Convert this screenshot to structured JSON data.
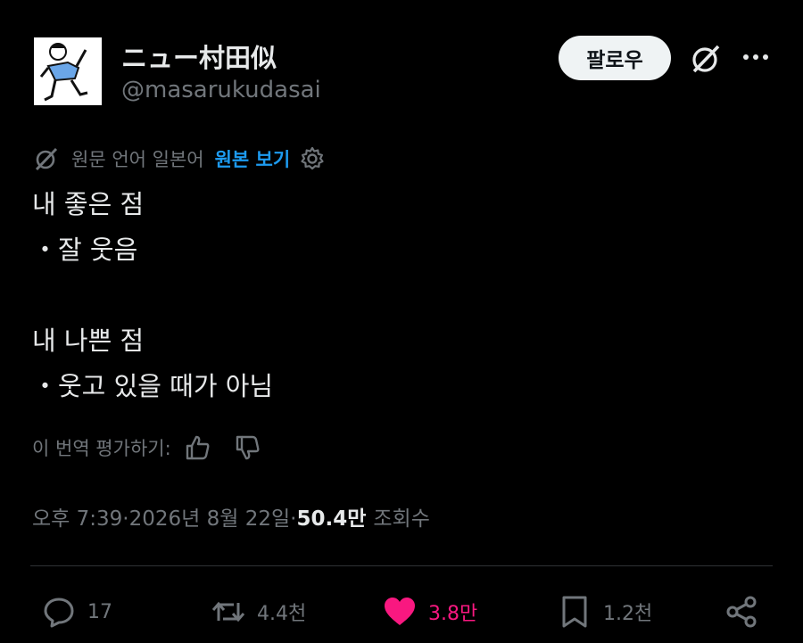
{
  "author": {
    "display_name": "ニュー村田似",
    "handle": "@masarukudasai"
  },
  "header": {
    "follow_label": "팔로우"
  },
  "translation": {
    "source_label": "원문 언어 일본어",
    "show_original_label": "원본 보기"
  },
  "tweet": {
    "lines": [
      "내 좋은 점",
      "・잘 웃음",
      "",
      "내 나쁜 점",
      "・웃고 있을 때가 아님"
    ]
  },
  "rating": {
    "label": "이 번역 평가하기:"
  },
  "meta": {
    "time": "오후 7:39",
    "separator": " · ",
    "date": "2026년 8월 22일",
    "views_count": "50.4만",
    "views_label": "조회수"
  },
  "actions": {
    "replies": "17",
    "reposts": "4.4천",
    "likes": "3.8만",
    "bookmarks": "1.2천"
  },
  "colors": {
    "background": "#000000",
    "text": "#e7e9ea",
    "secondary": "#71767b",
    "link": "#1d9bf0",
    "like": "#f91880",
    "divider": "#2f3336"
  },
  "icons": {
    "grok": "grok-icon",
    "more": "more-icon",
    "reply": "reply-icon",
    "repost": "repost-icon",
    "like": "heart-icon",
    "bookmark": "bookmark-icon",
    "share": "share-icon"
  }
}
